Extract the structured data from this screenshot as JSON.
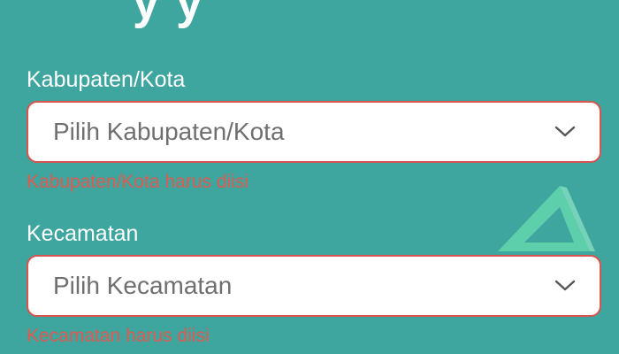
{
  "header": {
    "title_fragment": "y    y"
  },
  "form": {
    "kabupaten": {
      "label": "Kabupaten/Kota",
      "placeholder": "Pilih Kabupaten/Kota",
      "error": "Kabupaten/Kota harus diisi"
    },
    "kecamatan": {
      "label": "Kecamatan",
      "placeholder": "Pilih Kecamatan",
      "error": "Kecamatan harus diisi"
    }
  },
  "icons": {
    "dropdown": "chevron-down-icon",
    "decoration": "triangle-icon"
  },
  "colors": {
    "background": "#3fa59f",
    "error": "#e05a50",
    "field_border": "#d9534f",
    "placeholder": "#6f6f6f",
    "decoration": "#5fd3a8"
  }
}
